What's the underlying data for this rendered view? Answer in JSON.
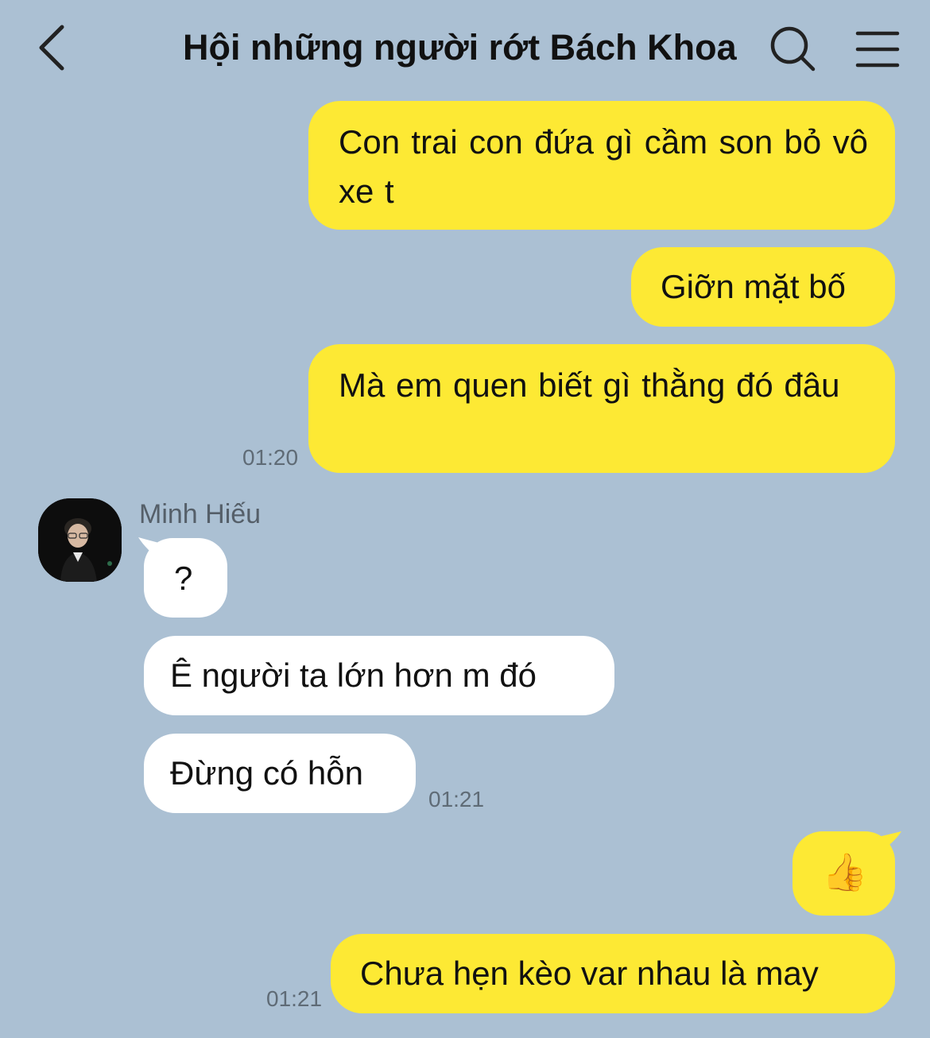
{
  "header": {
    "title": "Hội những người rớt Bách Khoa",
    "back_icon": "chevron-left-icon",
    "search_icon": "search-icon",
    "menu_icon": "hamburger-menu-icon"
  },
  "colors": {
    "background": "#abc0d3",
    "my_bubble": "#fde934",
    "their_bubble": "#ffffff"
  },
  "messages": [
    {
      "sender": "me",
      "text": "Con trai con đứa gì cầm son bỏ vô xe t"
    },
    {
      "sender": "me",
      "text": "Giỡn mặt bố"
    },
    {
      "sender": "me",
      "text": "Mà em quen biết gì thằng đó đâu",
      "time": "01:20"
    },
    {
      "sender": "Minh Hiếu",
      "text": "?"
    },
    {
      "sender": "Minh Hiếu",
      "text": "Ê người ta lớn hơn m đó"
    },
    {
      "sender": "Minh Hiếu",
      "text": "Đừng có hỗn",
      "time": "01:21"
    },
    {
      "sender": "me",
      "text": "👍"
    },
    {
      "sender": "me",
      "text": "Chưa hẹn kèo var nhau là may",
      "time": "01:21"
    }
  ],
  "contact": {
    "name": "Minh Hiếu"
  }
}
